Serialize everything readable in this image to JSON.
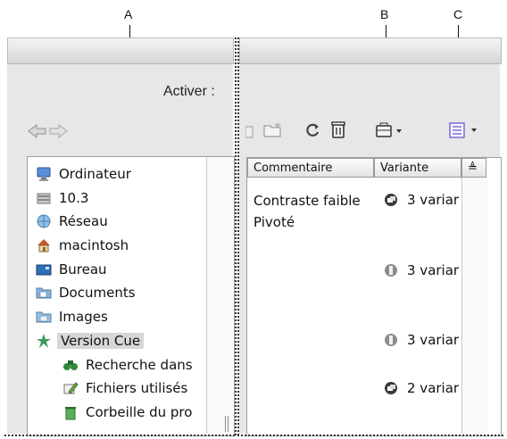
{
  "callouts": {
    "a": "A",
    "b": "B",
    "c": "C"
  },
  "left_panel": {
    "activer_label": "Activer :",
    "tree": [
      {
        "label": "Ordinateur",
        "icon": "computer-icon"
      },
      {
        "label": "10.3",
        "icon": "hard-drive-icon"
      },
      {
        "label": "Réseau",
        "icon": "network-globe-icon"
      },
      {
        "label": "macintosh",
        "icon": "home-icon"
      },
      {
        "label": "Bureau",
        "icon": "desktop-icon"
      },
      {
        "label": "Documents",
        "icon": "documents-folder-icon"
      },
      {
        "label": "Images",
        "icon": "images-folder-icon"
      },
      {
        "label": "Version Cue",
        "icon": "version-cue-icon",
        "selected": true
      },
      {
        "label": "Recherche dans",
        "icon": "binoculars-icon"
      },
      {
        "label": "Fichiers utilisés",
        "icon": "pencil-icon"
      },
      {
        "label": "Corbeille du pro",
        "icon": "trash-icon"
      }
    ]
  },
  "right_panel": {
    "columns": {
      "comment": "Commentaire",
      "variant": "Variante",
      "sort": "≜"
    },
    "comments": [
      "Contraste faible",
      "Pivoté"
    ],
    "variants": [
      {
        "text": "3 variar",
        "icon": "variant-dark-icon"
      },
      {
        "text": "3 variar",
        "icon": "variant-light-icon"
      },
      {
        "text": "3 variar",
        "icon": "variant-light-icon"
      },
      {
        "text": "2 variar",
        "icon": "variant-dark-icon"
      }
    ]
  },
  "colors": {
    "panel": "#e7e7e7",
    "list": "#ffffff",
    "selected": "#d7d7d7"
  }
}
